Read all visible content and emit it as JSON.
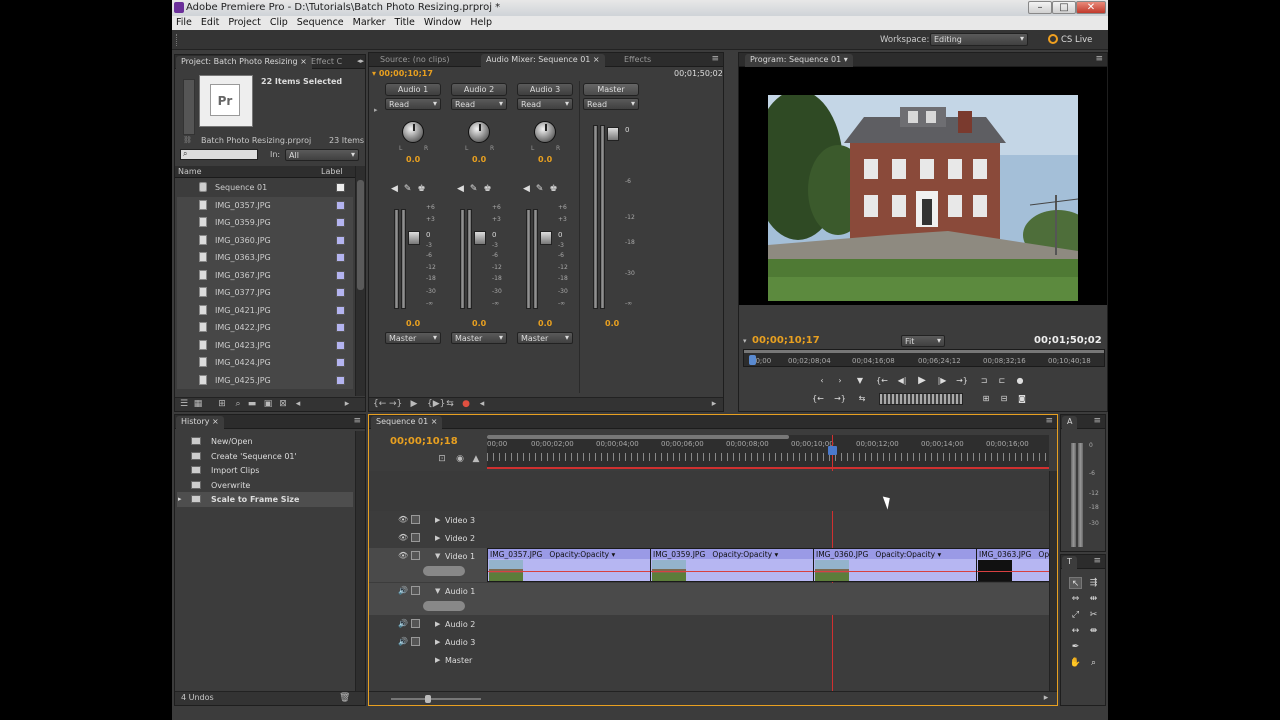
{
  "app": {
    "title": "Adobe Premiere Pro - D:\\Tutorials\\Batch Photo Resizing.prproj *"
  },
  "menu": [
    "File",
    "Edit",
    "Project",
    "Clip",
    "Sequence",
    "Marker",
    "Title",
    "Window",
    "Help"
  ],
  "workspace": {
    "label": "Workspace:",
    "value": "Editing",
    "cs_live": "CS Live"
  },
  "project": {
    "tab": "Project: Batch Photo Resizing",
    "tab2": "Effect C",
    "badge": "Pr",
    "selected": "22 Items Selected",
    "file": "Batch Photo Resizing.prproj",
    "count": "23 Items",
    "in_label": "In:",
    "in_value": "All",
    "col_name": "Name",
    "col_label": "Label",
    "items": [
      "Sequence 01",
      "IMG_0357.JPG",
      "IMG_0359.JPG",
      "IMG_0360.JPG",
      "IMG_0363.JPG",
      "IMG_0367.JPG",
      "IMG_0377.JPG",
      "IMG_0421.JPG",
      "IMG_0422.JPG",
      "IMG_0423.JPG",
      "IMG_0424.JPG",
      "IMG_0425.JPG"
    ]
  },
  "mixer": {
    "tabs": [
      "Source: (no clips)",
      "Audio Mixer: Sequence 01",
      "Effects"
    ],
    "tc_left": "00;00;10;17",
    "tc_right": "00;01;50;02",
    "channels": [
      {
        "name": "Audio 1",
        "mode": "Read",
        "value": "0.0",
        "out": "Master"
      },
      {
        "name": "Audio 2",
        "mode": "Read",
        "value": "0.0",
        "out": "Master"
      },
      {
        "name": "Audio 3",
        "mode": "Read",
        "value": "0.0",
        "out": "Master"
      }
    ],
    "master": {
      "name": "Master",
      "mode": "Read",
      "value": "0.0"
    },
    "l": "L",
    "r": "R",
    "scale": [
      "+6",
      "+3",
      "0",
      "-3",
      "-6",
      "-12",
      "-18",
      "-30",
      "-∞"
    ],
    "master_scale": [
      "0",
      "-6",
      "-12",
      "-18",
      "-30",
      "-∞"
    ]
  },
  "program": {
    "tab": "Program: Sequence 01",
    "tc_left": "00;00;10;17",
    "fit": "Fit",
    "tc_right": "00;01;50;02",
    "ruler": [
      "00;00",
      "00;02;08;04",
      "00;04;16;08",
      "00;06;24;12",
      "00;08;32;16",
      "00;10;40;18"
    ]
  },
  "history": {
    "tab": "History",
    "items": [
      "New/Open",
      "Create 'Sequence 01'",
      "Import Clips",
      "Overwrite",
      "Scale to Frame Size"
    ],
    "undos": "4 Undos"
  },
  "timeline": {
    "tab": "Sequence 01",
    "tc": "00;00;10;18",
    "ruler": [
      "00;00",
      "00;00;02;00",
      "00;00;04;00",
      "00;00;06;00",
      "00;00;08;00",
      "00;00;10;00",
      "00;00;12;00",
      "00;00;14;00",
      "00;00;16;00"
    ],
    "tracks": [
      "Video 3",
      "Video 2",
      "Video 1",
      "Audio 1",
      "Audio 2",
      "Audio 3",
      "Master"
    ],
    "clips": [
      {
        "name": "IMG_0357.JPG",
        "fx": "Opacity:Opacity"
      },
      {
        "name": "IMG_0359.JPG",
        "fx": "Opacity:Opacity"
      },
      {
        "name": "IMG_0360.JPG",
        "fx": "Opacity:Opacity"
      },
      {
        "name": "IMG_0363.JPG",
        "fx": "Op"
      }
    ]
  },
  "meters": {
    "tab": "A",
    "scale": [
      "0",
      "-6",
      "-12",
      "-18",
      "-30"
    ]
  },
  "tools": {
    "tab": "T"
  },
  "icons": {
    "eye": "eye-icon",
    "lock": "lock-icon",
    "speaker": "speaker-icon",
    "play": "play-icon"
  }
}
